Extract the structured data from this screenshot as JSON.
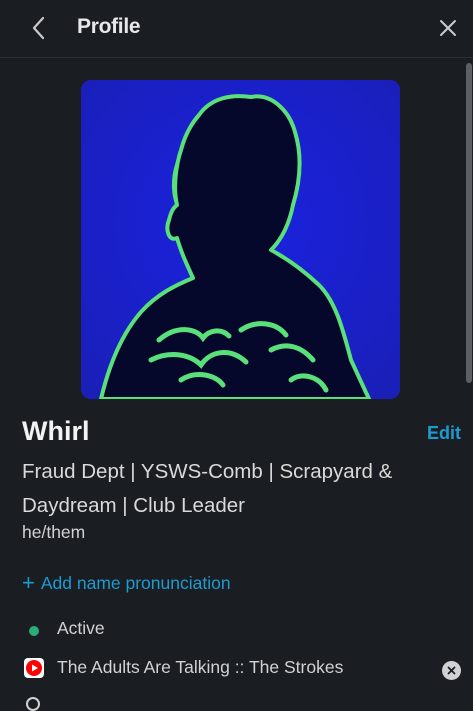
{
  "header": {
    "title": "Profile",
    "back_icon": "chevron-left-icon",
    "close_icon": "close-icon"
  },
  "profile": {
    "avatar_icon": "profile-photo",
    "name": "Whirl",
    "edit_label": "Edit",
    "title": "Fraud Dept | YSWS-Comb | Scrapyard & Daydream | Club Leader",
    "pronouns": "he/them",
    "add_pronunciation_label": "Add name pronunciation"
  },
  "status": {
    "presence": "Active",
    "presence_color": "#2bac76",
    "custom_status": "The Adults Are Talking :: The Strokes",
    "custom_status_icon": "youtube-icon"
  },
  "colors": {
    "background": "#1a1d21",
    "link": "#1d9bd1",
    "text": "#d1d2d3"
  }
}
